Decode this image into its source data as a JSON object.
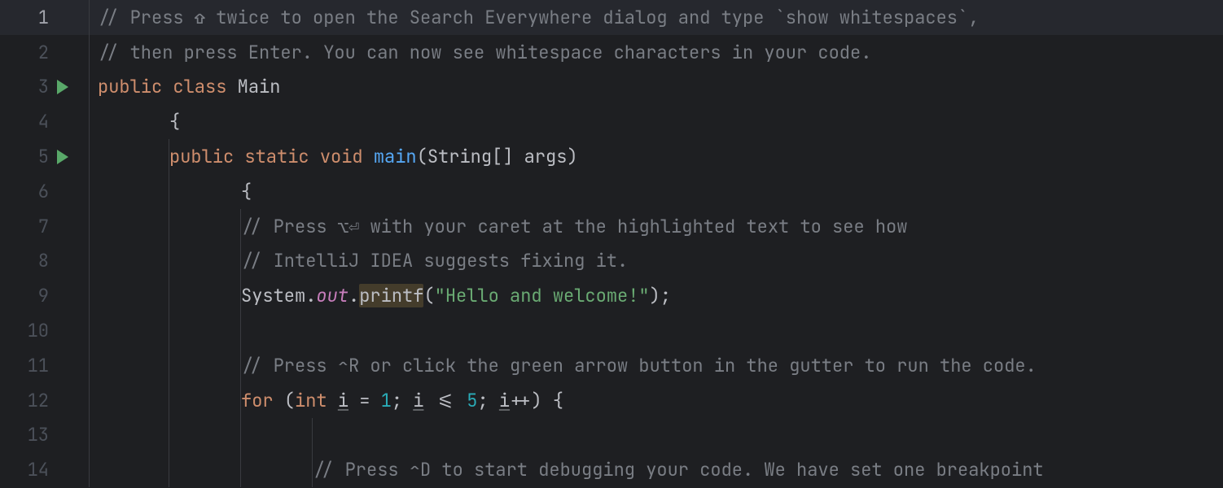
{
  "editor": {
    "lines": [
      {
        "n": 1,
        "current": true,
        "run": false
      },
      {
        "n": 2,
        "current": false,
        "run": false
      },
      {
        "n": 3,
        "current": false,
        "run": true
      },
      {
        "n": 4,
        "current": false,
        "run": false
      },
      {
        "n": 5,
        "current": false,
        "run": true
      },
      {
        "n": 6,
        "current": false,
        "run": false
      },
      {
        "n": 7,
        "current": false,
        "run": false
      },
      {
        "n": 8,
        "current": false,
        "run": false
      },
      {
        "n": 9,
        "current": false,
        "run": false
      },
      {
        "n": 10,
        "current": false,
        "run": false
      },
      {
        "n": 11,
        "current": false,
        "run": false
      },
      {
        "n": 12,
        "current": false,
        "run": false
      },
      {
        "n": 13,
        "current": false,
        "run": false
      },
      {
        "n": 14,
        "current": false,
        "run": false
      }
    ],
    "code": {
      "l1_comment": "// Press ⇧ twice to open the Search Everywhere dialog and type `show whitespaces`,",
      "l2_comment": "// then press Enter. You can now see whitespace characters in your code.",
      "l3_public": "public",
      "l3_class": "class",
      "l3_name": "Main",
      "l4_brace": "{",
      "l5_public": "public",
      "l5_static": "static",
      "l5_void": "void",
      "l5_main": "main",
      "l5_params_open": "(",
      "l5_string": "String",
      "l5_brackets": "[] ",
      "l5_args": "args",
      "l5_params_close": ")",
      "l6_brace": "{",
      "l7_comment": "// Press ⌥⏎ with your caret at the highlighted text to see how",
      "l8_comment": "// IntelliJ IDEA suggests fixing it.",
      "l9_system": "System",
      "l9_dot1": ".",
      "l9_out": "out",
      "l9_dot2": ".",
      "l9_printf": "printf",
      "l9_open": "(",
      "l9_string": "\"Hello and welcome!\"",
      "l9_close": ")",
      "l9_semi": ";",
      "l11_comment": "// Press ⌃R or click the green arrow button in the gutter to run the code.",
      "l12_for": "for",
      "l12_open": " (",
      "l12_int": "int",
      "l12_sp1": " ",
      "l12_i1": "i",
      "l12_eq": " = ",
      "l12_one": "1",
      "l12_semi1": "; ",
      "l12_i2": "i",
      "l12_le": " <= ",
      "l12_five": "5",
      "l12_semi2": "; ",
      "l12_i3": "i",
      "l12_pp": "++) {",
      "l14_comment": "// Press ⌃D to start debugging your code. We have set one breakpoint"
    }
  }
}
